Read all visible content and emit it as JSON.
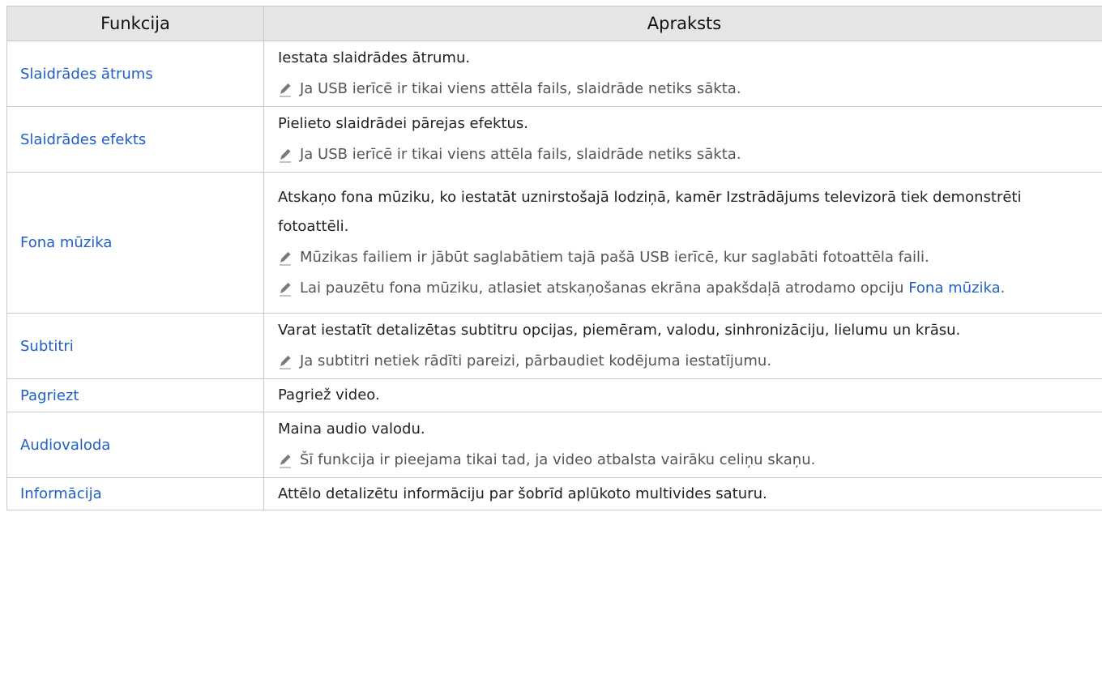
{
  "header": {
    "col1": "Funkcija",
    "col2": "Apraksts"
  },
  "icons": {
    "note": "pencil-icon"
  },
  "rows": [
    {
      "name": "Slaidrādes ātrums",
      "desc": "Iestata slaidrādes ātrumu.",
      "notes": [
        "Ja USB ierīcē ir tikai viens attēla fails, slaidrāde netiks sākta."
      ]
    },
    {
      "name": "Slaidrādes efekts",
      "desc": "Pielieto slaidrādei pārejas efektus.",
      "notes": [
        "Ja USB ierīcē ir tikai viens attēla fails, slaidrāde netiks sākta."
      ]
    },
    {
      "name": "Fona mūzika",
      "desc": "Atskaņo fona mūziku, ko iestatāt uznirstošajā lodziņā, kamēr Izstrādājums televizorā tiek demonstrēti fotoattēli.",
      "notes": [
        "Mūzikas failiem ir jābūt saglabātiem tajā pašā USB ierīcē, kur saglabāti fotoattēla faili.",
        "Lai pauzētu fona mūziku, atlasiet atskaņošanas ekrāna apakšdaļā atrodamo opciju"
      ],
      "note_ref": "Fona mūzika",
      "note_ref_suffix": "."
    },
    {
      "name": "Subtitri",
      "desc": "Varat iestatīt detalizētas subtitru opcijas, piemēram, valodu, sinhronizāciju, lielumu un krāsu.",
      "notes": [
        "Ja subtitri netiek rādīti pareizi, pārbaudiet kodējuma iestatījumu."
      ]
    },
    {
      "name": "Pagriezt",
      "desc": "Pagriež video."
    },
    {
      "name": "Audiovaloda",
      "desc": "Maina audio valodu.",
      "notes": [
        "Šī funkcija ir pieejama tikai tad, ja video atbalsta vairāku celiņu skaņu."
      ]
    },
    {
      "name": "Informācija",
      "desc": "Attēlo detalizētu informāciju par šobrīd aplūkoto multivides saturu."
    }
  ]
}
